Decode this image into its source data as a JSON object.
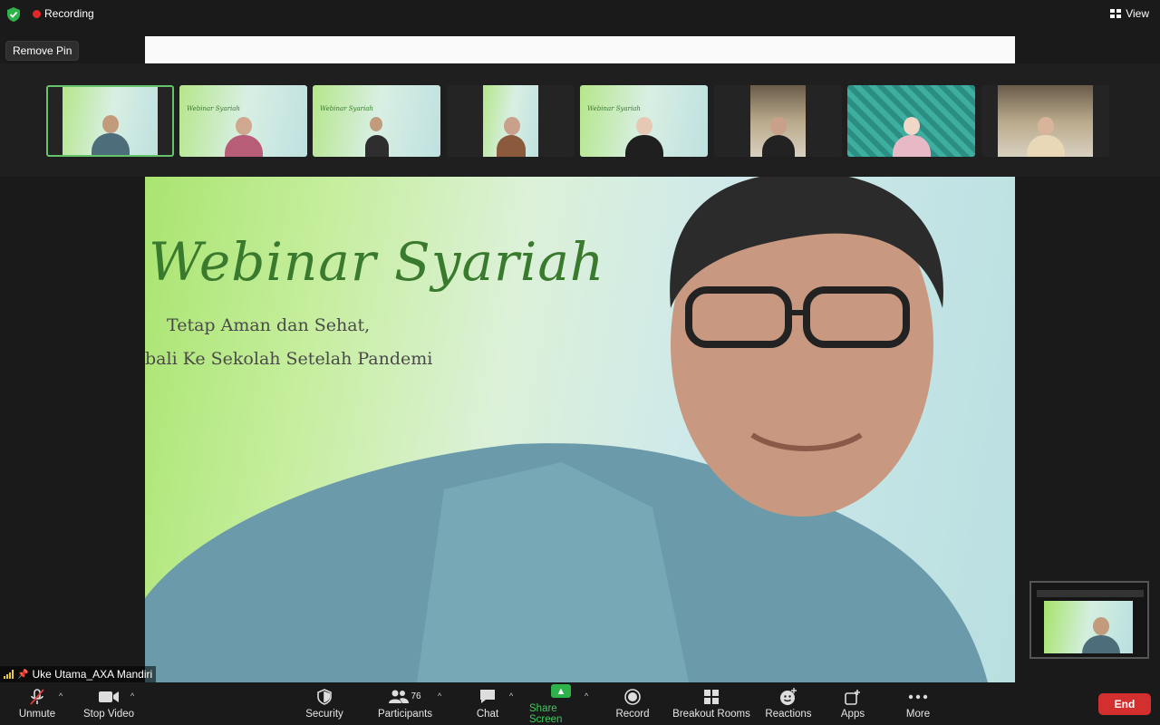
{
  "topbar": {
    "recording_label": "Recording",
    "view_label": "View"
  },
  "remove_pin_label": "Remove Pin",
  "main_slide": {
    "title": "Webinar Syariah",
    "subtitle_line1": "Tetap Aman dan Sehat,",
    "subtitle_line2": "bali Ke Sekolah Setelah Pandemi"
  },
  "thumbnail_text": "Webinar Syariah",
  "active_speaker": "Uke Utama_AXA Mandiri",
  "toolbar": {
    "unmute": "Unmute",
    "stop_video": "Stop Video",
    "security": "Security",
    "participants": "Participants",
    "participants_count": "76",
    "chat": "Chat",
    "share_screen": "Share Screen",
    "record": "Record",
    "breakout_rooms": "Breakout Rooms",
    "reactions": "Reactions",
    "apps": "Apps",
    "more": "More",
    "end": "End"
  },
  "colors": {
    "recording": "#e02828",
    "share": "#2db34a",
    "end": "#d42f2f",
    "active_border": "#65c36a"
  }
}
